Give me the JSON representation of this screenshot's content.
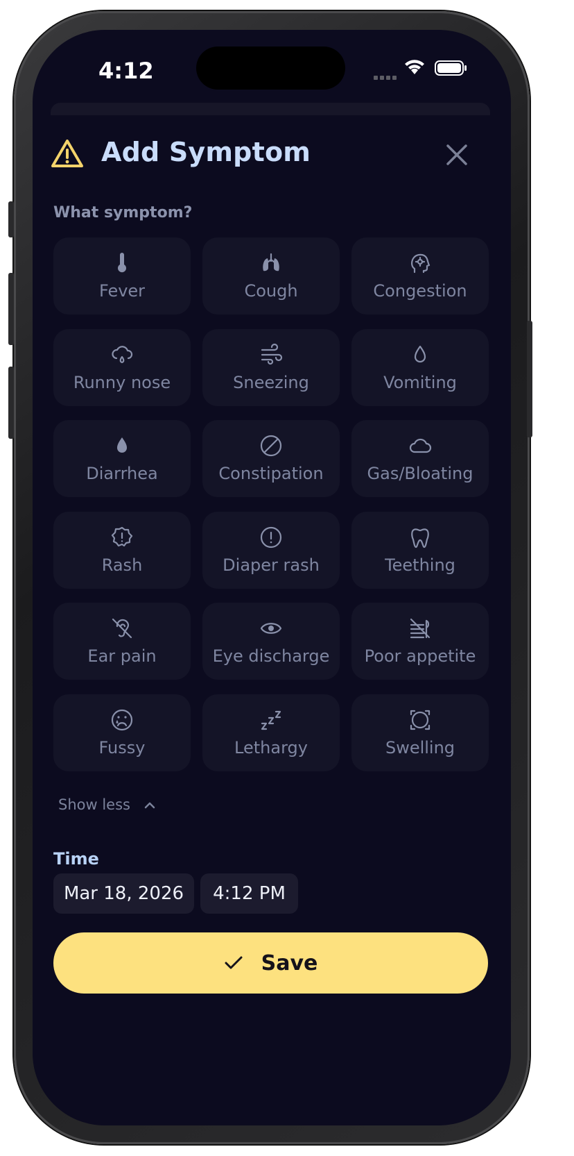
{
  "status_bar": {
    "time": "4:12"
  },
  "header": {
    "title": "Add Symptom"
  },
  "prompt": "What symptom?",
  "symptoms": [
    {
      "label": "Fever",
      "icon": "thermometer-icon"
    },
    {
      "label": "Cough",
      "icon": "lungs-icon"
    },
    {
      "label": "Congestion",
      "icon": "head-gear-icon"
    },
    {
      "label": "Runny nose",
      "icon": "cloud-drizzle-icon"
    },
    {
      "label": "Sneezing",
      "icon": "wind-icon"
    },
    {
      "label": "Vomiting",
      "icon": "droplet-outline-icon"
    },
    {
      "label": "Diarrhea",
      "icon": "droplet-filled-icon"
    },
    {
      "label": "Constipation",
      "icon": "ban-icon"
    },
    {
      "label": "Gas/Bloating",
      "icon": "cloud-icon"
    },
    {
      "label": "Rash",
      "icon": "badge-alert-icon"
    },
    {
      "label": "Diaper rash",
      "icon": "circle-alert-icon"
    },
    {
      "label": "Teething",
      "icon": "tooth-icon"
    },
    {
      "label": "Ear pain",
      "icon": "ear-off-icon"
    },
    {
      "label": "Eye discharge",
      "icon": "eye-icon"
    },
    {
      "label": "Poor appetite",
      "icon": "utensils-off-icon"
    },
    {
      "label": "Fussy",
      "icon": "sad-face-icon"
    },
    {
      "label": "Lethargy",
      "icon": "zzz-icon"
    },
    {
      "label": "Swelling",
      "icon": "expand-circle-icon"
    }
  ],
  "toggle": {
    "label": "Show less"
  },
  "time_section": {
    "label": "Time",
    "date": "Mar 18, 2026",
    "time": "4:12 PM"
  },
  "save": {
    "label": "Save"
  },
  "colors": {
    "background": "#0c0b1f",
    "tile": "#141427",
    "accent": "#fde17f",
    "warning": "#f3d36b",
    "title": "#c9dcfa"
  }
}
